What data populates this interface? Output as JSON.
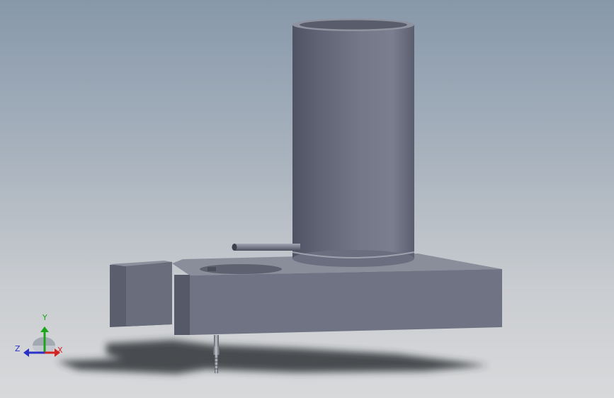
{
  "view": {
    "background_top": "#8798aa",
    "background_bottom": "#d8d9db",
    "model_color": "#6f7383"
  },
  "triad": {
    "x_label": "X",
    "y_label": "Y",
    "z_label": "Z",
    "x_color": "#d42323",
    "y_color": "#1aa51a",
    "z_color": "#2a31c8"
  }
}
